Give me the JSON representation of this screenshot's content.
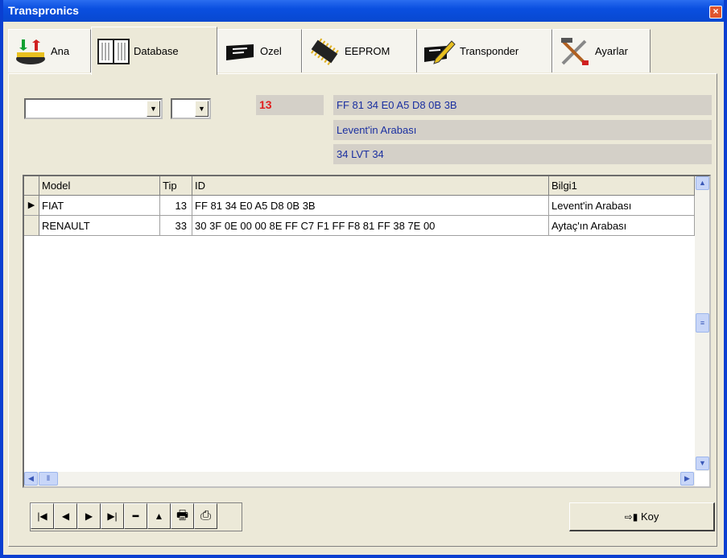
{
  "window": {
    "title": "Transpronics"
  },
  "tabs": [
    {
      "label": "Ana",
      "icon": "transfer-icon"
    },
    {
      "label": "Database",
      "icon": "book-icon"
    },
    {
      "label": "Ozel",
      "icon": "card-icon"
    },
    {
      "label": "EEPROM",
      "icon": "chip-icon"
    },
    {
      "label": "Transponder",
      "icon": "pencil-card-icon"
    },
    {
      "label": "Ayarlar",
      "icon": "tools-icon"
    }
  ],
  "active_tab": "Database",
  "form": {
    "combo1_value": "",
    "combo2_value": "",
    "tip": "13",
    "id": "FF 81 34 E0 A5 D8 0B 3B",
    "bilgi1": "Levent'in Arabası",
    "bilgi2": "34 LVT 34"
  },
  "grid": {
    "columns": [
      "Model",
      "Tip",
      "ID",
      "Bilgi1"
    ],
    "rows": [
      {
        "model": "FIAT",
        "tip": "13",
        "id": "FF 81 34 E0 A5 D8 0B 3B",
        "bilgi1": "Levent'in Arabası"
      },
      {
        "model": "RENAULT",
        "tip": "33",
        "id": "30 3F 0E 00 00 8E FF C7  F1 FF F8 81 FF 38 7E 00",
        "bilgi1": "Aytaç'ın Arabası"
      }
    ]
  },
  "navigator": [
    "first",
    "prior",
    "next",
    "last",
    "delete",
    "post",
    "print",
    "print-all"
  ],
  "koy_button": "Koy",
  "colors": {
    "title_bar": "#0a4fe0",
    "accent_red": "#e02020",
    "blue_text": "#1a2fa0"
  }
}
